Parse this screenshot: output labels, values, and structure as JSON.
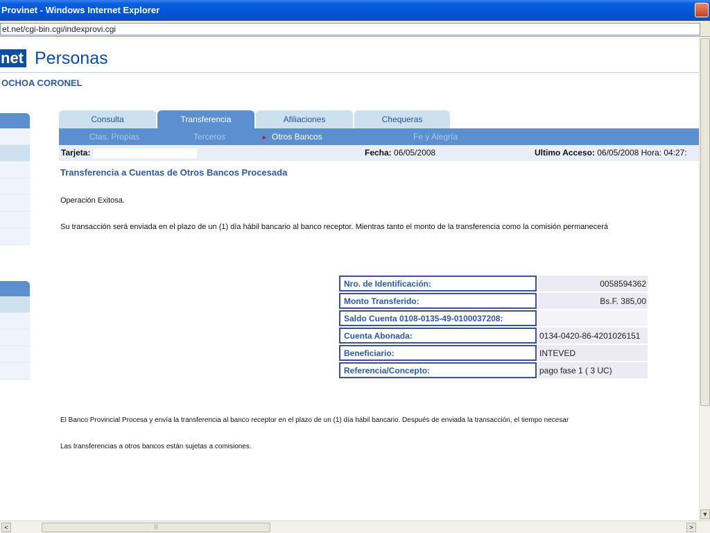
{
  "window": {
    "title": "Provinet - Windows Internet Explorer"
  },
  "address_bar": {
    "url": "et.net/cgi-bin.cgi/indexprovi.cgi"
  },
  "header": {
    "logo": "net",
    "section": "Personas",
    "user_name": "OCHOA CORONEL"
  },
  "tabs": [
    {
      "label": "Consulta",
      "active": false
    },
    {
      "label": "Transferencia",
      "active": true
    },
    {
      "label": "Afiliaciones",
      "active": false
    },
    {
      "label": "Chequeras",
      "active": false
    }
  ],
  "subnav": [
    {
      "label": "Ctas. Propias",
      "current": false
    },
    {
      "label": "Terceros",
      "current": false
    },
    {
      "label": "Otros Bancos",
      "current": true
    },
    {
      "label": "Fe y Alegría",
      "current": false
    }
  ],
  "infobar": {
    "card_label": "Tarjeta:",
    "date_label": "Fecha:",
    "date_value": "06/05/2008",
    "last_access_label": "Ultimo Acceso:",
    "last_access_value": "06/05/2008 Hora: 04:27:"
  },
  "content": {
    "title": "Transferencia a Cuentas de Otros Bancos Procesada",
    "status": "Operación Exitosa.",
    "message": "Su transacción será enviada en el plazo de un (1) día hábil bancario al banco receptor. Mientras tanto el monto de la transferencia como la comisión permanecerá",
    "details": [
      {
        "label": "Nro. de Identificación:",
        "value": "0058594362"
      },
      {
        "label": "Monto Transferido:",
        "value": "Bs.F. 385,00"
      },
      {
        "label": "Saldo Cuenta 0108-0135-49-0100037208:",
        "value": ""
      },
      {
        "label": "Cuenta Abonada:",
        "value": "0134-0420-86-4201026151"
      },
      {
        "label": "Beneficiario:",
        "value": "INTEVED"
      },
      {
        "label": "Referencia/Concepto:",
        "value": "pago fase 1 ( 3 UC)"
      }
    ],
    "footer_note_1": "El Banco Provincial Procesa y envía la transferencia al banco receptor en el plazo de un (1) día hábil bancario. Después de enviada la transacción, el tiempo necesar",
    "footer_note_2": "Las transferencias a otros bancos están sujetas a comisiones."
  }
}
